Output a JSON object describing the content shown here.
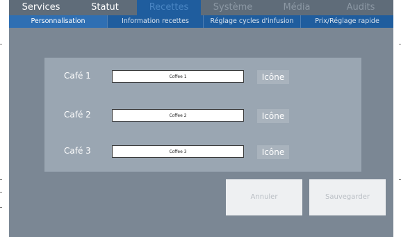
{
  "top_tabs": [
    {
      "label": "Services",
      "state": "normal"
    },
    {
      "label": "Statut",
      "state": "normal"
    },
    {
      "label": "Recettes",
      "state": "active"
    },
    {
      "label": "Système",
      "state": "disabled"
    },
    {
      "label": "Média",
      "state": "disabled"
    },
    {
      "label": "Audits",
      "state": "disabled"
    }
  ],
  "sub_tabs": [
    {
      "label": "Personnalisation",
      "state": "active"
    },
    {
      "label": "Information recettes",
      "state": "normal"
    },
    {
      "label": "Réglage cycles d'infusion",
      "state": "normal"
    },
    {
      "label": "Prix/Réglage rapide",
      "state": "normal"
    }
  ],
  "cafes": [
    {
      "label": "Café 1",
      "value": "Coffee 1",
      "icon_button": "Icône"
    },
    {
      "label": "Café 2",
      "value": "Coffee 2",
      "icon_button": "Icône"
    },
    {
      "label": "Café 3",
      "value": "Coffee 3",
      "icon_button": "Icône"
    }
  ],
  "actions": {
    "cancel_label": "Annuler",
    "save_label": "Sauvegarder"
  },
  "colors": {
    "screen_bg": "#7b8794",
    "panel_bg": "#9aa6b2",
    "accent_blue": "#1f5d9e"
  }
}
